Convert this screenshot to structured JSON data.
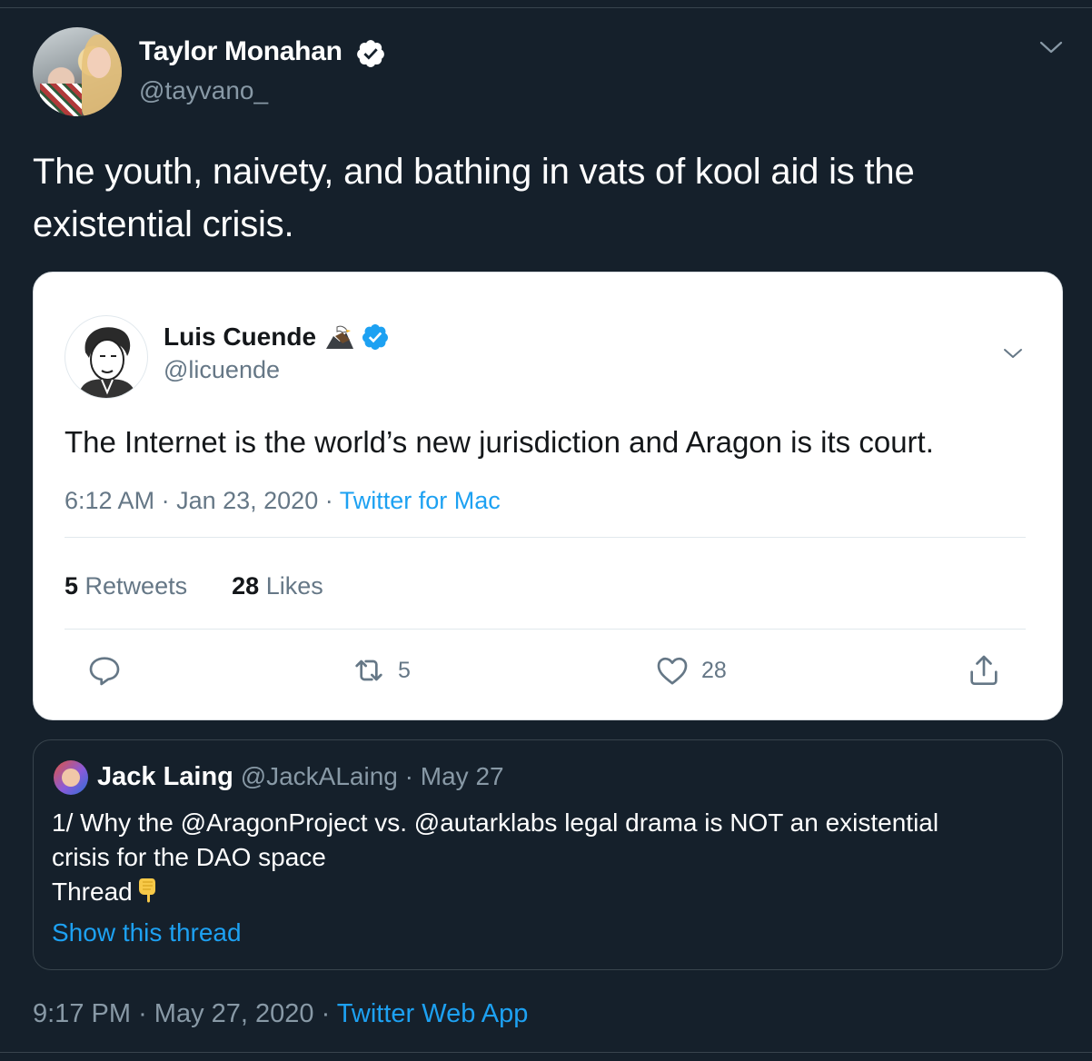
{
  "tweet": {
    "author": {
      "name": "Taylor Monahan",
      "handle": "@tayvano_"
    },
    "text": "The youth, naivety, and bathing in vats of kool aid is the existential crisis.",
    "footer": {
      "time": "9:17 PM",
      "date": "May 27, 2020",
      "source": "Twitter Web App"
    }
  },
  "embedded": {
    "author": {
      "name": "Luis Cuende",
      "handle": "@licuende"
    },
    "text": "The Internet is the world’s new jurisdiction and Aragon is its court.",
    "time": "6:12 AM",
    "date": "Jan 23, 2020",
    "source": "Twitter for Mac",
    "stats": {
      "retweets_count": "5",
      "retweets_label": "Retweets",
      "likes_count": "28",
      "likes_label": "Likes"
    },
    "actions": {
      "retweet_count": "5",
      "like_count": "28"
    }
  },
  "quoted": {
    "author": {
      "name": "Jack Laing",
      "handle": "@JackALaing"
    },
    "date": "May 27",
    "line1": "1/ Why the @AragonProject vs. @autarklabs legal drama is NOT an existential",
    "line2": "crisis for the DAO space",
    "line3": "Thread",
    "show_thread": "Show this thread"
  },
  "colors": {
    "background": "#15202b",
    "accent": "#1da1f2",
    "muted": "#8899a6",
    "border": "#38444d"
  },
  "icons": [
    "verified-badge-icon",
    "chevron-down-icon",
    "eagle-emoji-icon",
    "reply-icon",
    "retweet-icon",
    "like-icon",
    "share-icon",
    "pointing-down-emoji-icon"
  ]
}
